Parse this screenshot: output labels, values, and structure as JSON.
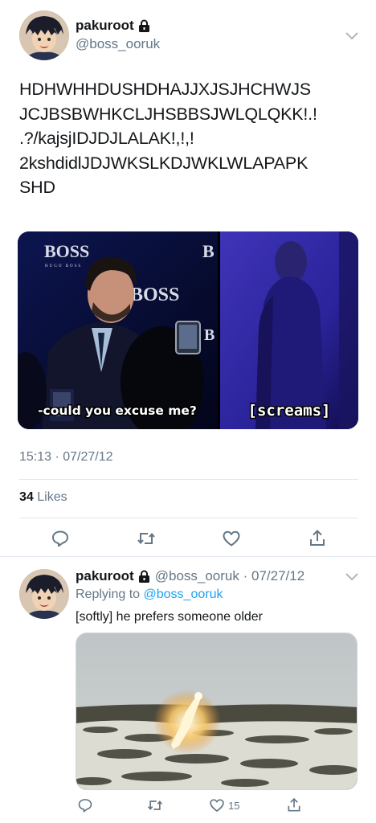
{
  "main_tweet": {
    "display_name": "pakuroot",
    "handle": "@boss_ooruk",
    "text_lines": [
      "HDHWHHDUSHDHAJJXJSJHCHWJS",
      "JCJBSBWHKCLJHSBBSJWLQLQKK!.!",
      ".?/kajsjIDJDJLALAK!,!,!",
      "2kshdidlJDJWKSLKDJWKLWLAPAPK",
      "SHD"
    ],
    "media": {
      "caption_left": "-could you excuse me?",
      "caption_right": "[screams]",
      "logo_text": "BOSS",
      "logo_sub": "HUGO BOSS"
    },
    "timestamp": "15:13 · 07/27/12",
    "likes_count": "34",
    "likes_label": "Likes"
  },
  "reply_tweet": {
    "display_name": "pakuroot",
    "handle_time": "@boss_ooruk · 07/27/12",
    "replying_prefix": "Replying to",
    "replying_handle": "@boss_ooruk",
    "text": "[softly] he prefers someone older",
    "like_count": "15"
  },
  "icons": {
    "reply": "reply-icon",
    "retweet": "retweet-icon",
    "like": "heart-icon",
    "share": "share-icon",
    "lock": "lock-icon",
    "chevron": "chevron-down-icon"
  },
  "colors": {
    "text": "#14171a",
    "secondary": "#657786",
    "link": "#1da1f2",
    "divider": "#e1e8ed"
  }
}
